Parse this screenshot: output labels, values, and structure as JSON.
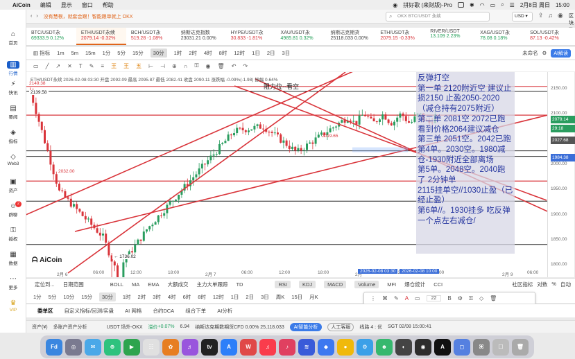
{
  "menubar": {
    "app": "AiCoin",
    "items": [
      "编辑",
      "显示",
      "窗口",
      "帮助"
    ],
    "status": "拼好歌 (来财版)-Pro",
    "date": "2月8日 周日",
    "time": "15:00"
  },
  "sidebar": [
    {
      "label": "首页",
      "icon": "home-icon"
    },
    {
      "label": "行情",
      "icon": "chart-icon"
    },
    {
      "label": "快讯",
      "icon": "news-icon"
    },
    {
      "label": "要闻",
      "icon": "newspaper-icon"
    },
    {
      "label": "指标",
      "icon": "indicator-icon"
    },
    {
      "label": "Web3",
      "icon": "web3-icon"
    },
    {
      "label": "资产",
      "icon": "wallet-icon"
    },
    {
      "label": "群聊",
      "icon": "chat-icon",
      "badge": "2"
    },
    {
      "label": "授权",
      "icon": "key-icon"
    },
    {
      "label": "数据",
      "icon": "data-icon"
    },
    {
      "label": "更多",
      "icon": "more-icon"
    },
    {
      "label": "VIP",
      "icon": "vip-icon"
    }
  ],
  "topbar": {
    "back": "‹",
    "fwd": "›",
    "tab_text": "没有慧根，就套会跟！智能跟单就上 OKX",
    "search_placeholder": "OKX BTC/USDT 永续",
    "currency": "USD",
    "login": "区块链博子"
  },
  "tickers": [
    {
      "name": "BTC/USDT永",
      "price": "69333.9",
      "change": "0.12%",
      "color": "#1f9d55"
    },
    {
      "name": "ETH/USDT永续",
      "price": "2079.14",
      "change": "-0.32%",
      "color": "#d9343a"
    },
    {
      "name": "BCH/USDT永",
      "price": "519.28",
      "change": "-1.08%",
      "color": "#d9343a"
    },
    {
      "name": "纳斯达克指数",
      "price": "23031.21",
      "change": "0.00%",
      "color": "#444"
    },
    {
      "name": "HYPE/USDT永",
      "price": "30.833",
      "change": "-1.81%",
      "color": "#d9343a"
    },
    {
      "name": "XAU/USDT永",
      "price": "4985.81",
      "change": "0.32%",
      "color": "#1f9d55"
    },
    {
      "name": "纳斯达克期货",
      "price": "25118.033",
      "change": "0.00%",
      "color": "#444"
    },
    {
      "name": "ETH/USDT永",
      "price": "2079.15",
      "change": "-0.33%",
      "color": "#d9343a"
    },
    {
      "name": "RIVER/USDT",
      "price": "13.109",
      "change": "2.23%",
      "color": "#1f9d55"
    },
    {
      "name": "XAG/USDT永",
      "price": "78.08",
      "change": "0.18%",
      "color": "#1f9d55"
    },
    {
      "name": "SOL/USDT永",
      "price": "87.13",
      "change": "-0.42%",
      "color": "#d9343a"
    }
  ],
  "toolbar1": {
    "items": [
      "指标",
      "1m",
      "5m",
      "15m",
      "1分",
      "5分",
      "15分",
      "30分",
      "1时",
      "2时",
      "4时",
      "8时",
      "12时",
      "1日",
      "2日",
      "3日"
    ],
    "active": "30分",
    "right": [
      "未命名",
      "AI解读"
    ]
  },
  "toolbar2": {
    "icons": [
      "box-icon",
      "line-icon",
      "ray-icon",
      "cross-icon",
      "text-icon",
      "pen-icon",
      "fib-icon"
    ],
    "marks": [
      "王",
      "王",
      "五"
    ]
  },
  "chart": {
    "info": "ETH/USDT永续 2026-02-08 03:30 开盘 2092.09 最高 2095.87 最低 2082.41 收盘 2090.11 涨跌幅 -0.09%(-1.98) 振幅 0.64%",
    "resistance_label": "阻力位--看空",
    "price_labels": {
      "p2149": "2149.38",
      "p2139": "2139.58",
      "p2032": "2032.00",
      "p2019": "2019.65",
      "p1736": "← 1736.02"
    },
    "y_ticks": [
      "2150.00",
      "2100.00",
      "2050.00",
      "2000.00",
      "1950.00",
      "1900.00",
      "1850.00",
      "1800.00",
      "1750.00"
    ],
    "y_boxes": [
      {
        "value": "2079.14",
        "color": "#2a9d5f"
      },
      {
        "value": "29:18",
        "color": "#2a9d5f"
      },
      {
        "value": "2027.68",
        "color": "#555"
      },
      {
        "value": "1984.38",
        "color": "#3b6ed8"
      }
    ],
    "x_ticks": [
      "2月 6",
      "06:00",
      "12:00",
      "18:00",
      "2月 7",
      "06:00",
      "12:00",
      "18:00",
      "2月",
      "12:00",
      "18:00",
      "2月 9",
      "06:00"
    ],
    "time_sel_start": "2026-02-08 03:30",
    "time_sel_end": "2026-02-08 10:00",
    "note": [
      "反弹打空",
      "第一单 2120附近空  建议止损2150 止盈2050-2020（减仓持有2075附近）",
      "第二单 2081空  2072已跑看到价格2064建议减仓",
      "第三单 2051空。2042已跑",
      "第4单。2030空。1980减仓-1930附近全部离场",
      "第5单。2048空。2040跑了 2分钟单",
      "       2115挂单空//1030止盈（已经止盈）",
      "第6单//。1930挂多  吃反弹一个点左右减仓/"
    ],
    "logo": "AiCoin"
  },
  "indicators": {
    "left": [
      "定位到...",
      "日期范围"
    ],
    "items": [
      "BOLL",
      "MA",
      "EMA",
      "大额成交",
      "主力大单跟踪",
      "TD",
      "RSI",
      "KDJ",
      "MACD",
      "Volume",
      "MFI",
      "爆仓统计",
      "CCI"
    ],
    "active": [
      "RSI",
      "KDJ",
      "MACD",
      "Volume"
    ],
    "right": [
      "社区指标",
      "对数",
      "%",
      "自动"
    ]
  },
  "timeframes": {
    "items": [
      "1分",
      "5分",
      "10分",
      "15分",
      "30分",
      "1时",
      "2时",
      "3时",
      "4时",
      "6时",
      "8时",
      "12时",
      "1日",
      "2日",
      "3日",
      "周K",
      "15日",
      "月K"
    ],
    "active": "30分"
  },
  "draw_toolbar": {
    "font_size": "22"
  },
  "bottom_tabs": [
    "委单区",
    "自定义指标/回测/实盘",
    "AI 网格",
    "合约DCA",
    "组合下单",
    "AI分析"
  ],
  "statusbar": {
    "assets": "资产(¥)",
    "analysis": "多账户资产分析",
    "pair": "USDT 场外-OKX",
    "change_label": "溢价",
    "change": "+0.07%",
    "change2": "6.94",
    "nasdaq": "纳斯达克期数期货CFD  0.00%  25,118.033",
    "ai_btn": "AI智能分析",
    "cs_btn": "人工客服",
    "route": "线路 4 : 优",
    "time": "SGT 02/08 15:00:41"
  },
  "dock": [
    {
      "label": "Fd",
      "color": "#3a86e0"
    },
    {
      "label": "◎",
      "color": "#7a7a90"
    },
    {
      "label": "✉",
      "color": "#4aa8e8"
    },
    {
      "label": "⊕",
      "color": "#2ec27e"
    },
    {
      "label": "▶",
      "color": "#2da44e"
    },
    {
      "label": "☷",
      "color": "#e0e0e0"
    },
    {
      "label": "✿",
      "color": "#e77e22"
    },
    {
      "label": "♬",
      "color": "#9955dd"
    },
    {
      "label": "tv",
      "color": "#222"
    },
    {
      "label": "A",
      "color": "#2d7ff9"
    },
    {
      "label": "W",
      "color": "#e04848"
    },
    {
      "label": "♫",
      "color": "#fa3c4c"
    },
    {
      "label": "♪",
      "color": "#e04060"
    },
    {
      "label": "≋",
      "color": "#3a5bd9"
    },
    {
      "label": "◆",
      "color": "#3d78f0"
    },
    {
      "label": "●",
      "color": "#f0b90b"
    },
    {
      "label": "⚙",
      "color": "#3ba0e8"
    },
    {
      "label": "☻",
      "color": "#36b86e"
    },
    {
      "label": "◐",
      "color": "#444"
    },
    {
      "label": "◉",
      "color": "#2d2d2d"
    },
    {
      "label": "A",
      "color": "#111"
    },
    {
      "label": "◻",
      "color": "#5580e0"
    },
    {
      "label": "⌘",
      "color": "#888"
    },
    {
      "label": "☐",
      "color": "#bbb"
    },
    {
      "label": "🗑",
      "color": "#aaa"
    }
  ]
}
